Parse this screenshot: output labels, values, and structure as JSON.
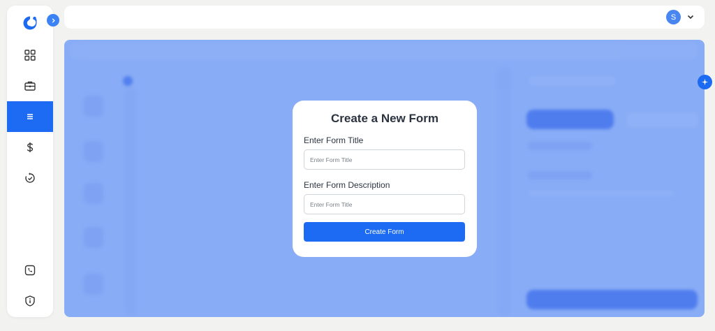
{
  "nav": {
    "items": [
      {
        "icon": "dashboard-grid-icon"
      },
      {
        "icon": "briefcase-icon"
      },
      {
        "icon": "list-menu-icon",
        "active": true
      },
      {
        "icon": "dollar-icon"
      },
      {
        "icon": "history-check-icon"
      }
    ],
    "bottom_items": [
      {
        "icon": "phone-icon"
      },
      {
        "icon": "info-shield-icon"
      }
    ]
  },
  "header": {
    "avatar_initial": "S"
  },
  "modal": {
    "title": "Create a New Form",
    "title_label": "Enter Form Title",
    "title_placeholder": "Enter Form Title",
    "description_label": "Enter Form Description",
    "description_placeholder": "Enter Form Title",
    "submit_label": "Create Form"
  },
  "colors": {
    "accent": "#1c6bf2",
    "overlay": "#88acf6",
    "avatar": "#4a86f0",
    "background": "#f2f2f0"
  }
}
